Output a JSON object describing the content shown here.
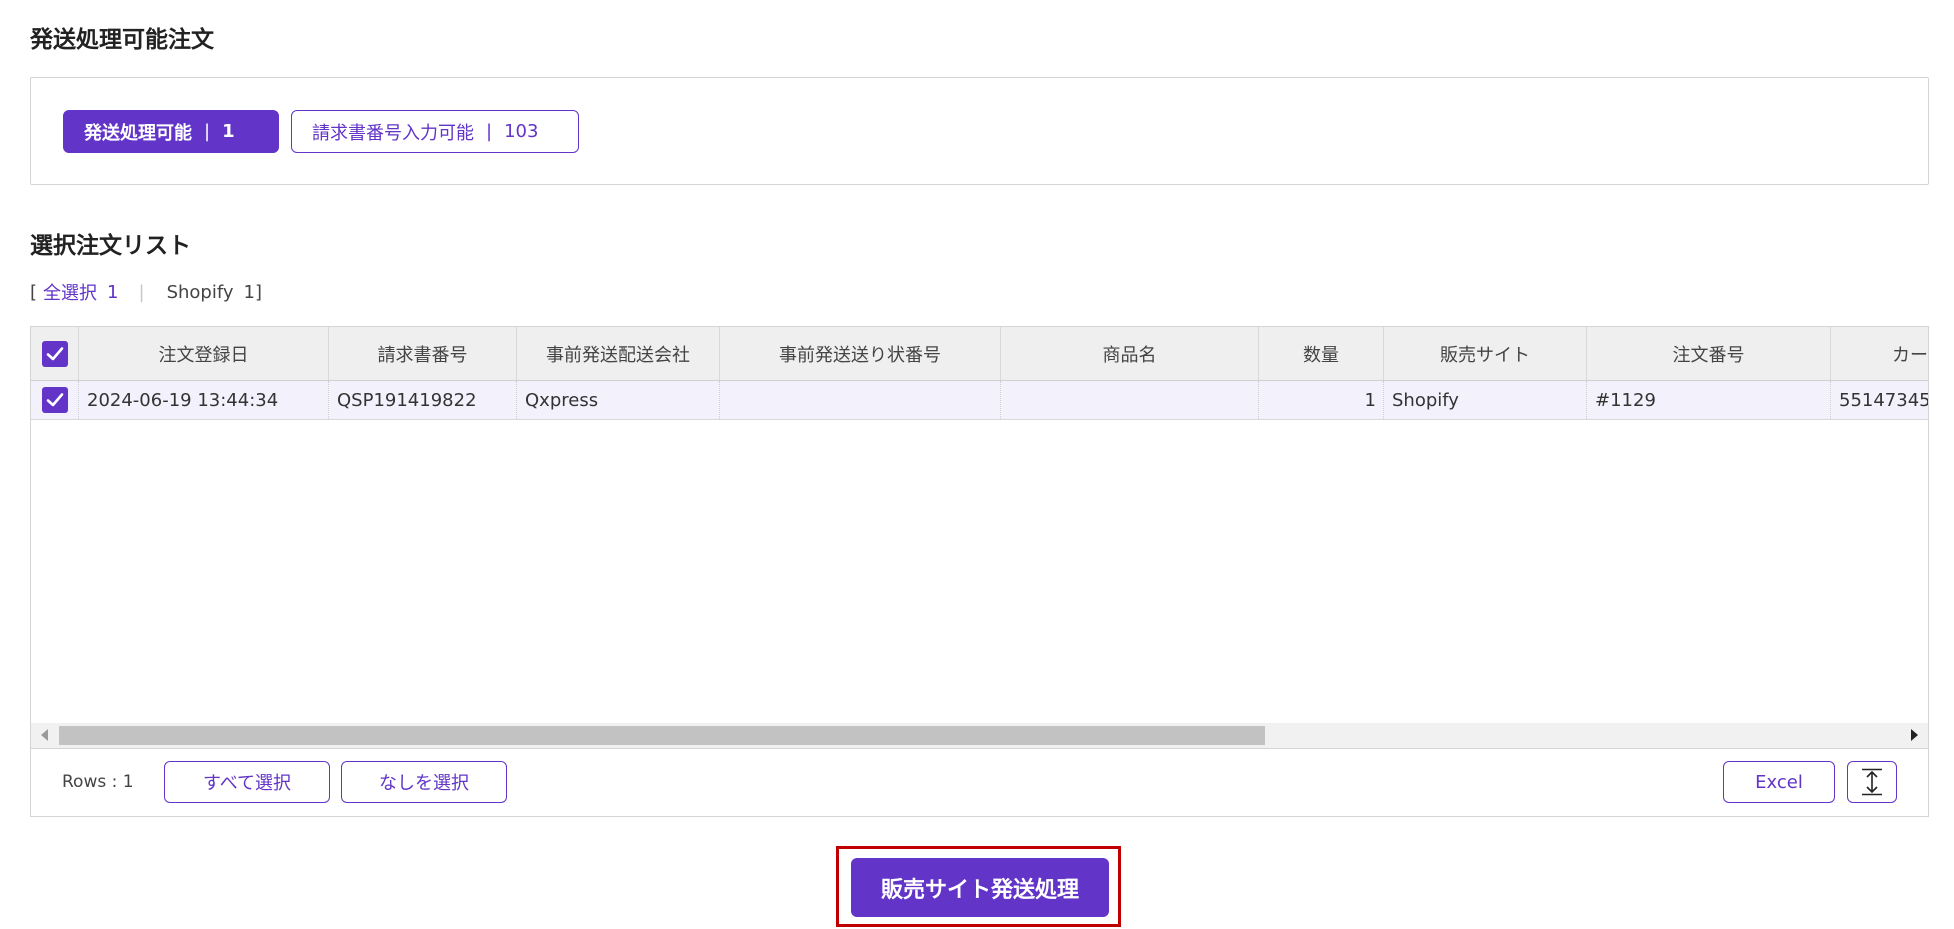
{
  "section1": {
    "title": "発送処理可能注文"
  },
  "filters": [
    {
      "label": "発送処理可能",
      "count": "1"
    },
    {
      "label": "請求書番号入力可能",
      "count": "103"
    }
  ],
  "section2": {
    "title": "選択注文リスト"
  },
  "selection": {
    "open_bracket": "[",
    "all_label": "全選択",
    "all_count": "1",
    "divider": "|",
    "shopify_label": "Shopify",
    "shopify_count": "1",
    "close_bracket": "]"
  },
  "table": {
    "columns": [
      "注文登録日",
      "請求書番号",
      "事前発送配送会社",
      "事前発送送り状番号",
      "商品名",
      "数量",
      "販売サイト",
      "注文番号",
      "カー"
    ],
    "rows": [
      {
        "checked": true,
        "cells": [
          "2024-06-19 13:44:34",
          "QSP191419822",
          "Qxpress",
          "",
          "",
          "1",
          "Shopify",
          "#1129",
          "55147345"
        ]
      }
    ]
  },
  "footer": {
    "rows_label": "Rows : 1",
    "select_all": "すべて選択",
    "select_none": "なしを選択",
    "excel": "Excel"
  },
  "primary_action": "販売サイト発送処理",
  "colors": {
    "accent": "#6234c8",
    "highlight_border": "#c00000"
  },
  "icons": {
    "checkbox": "checkmark-icon",
    "resize": "expand-vertical-icon"
  }
}
